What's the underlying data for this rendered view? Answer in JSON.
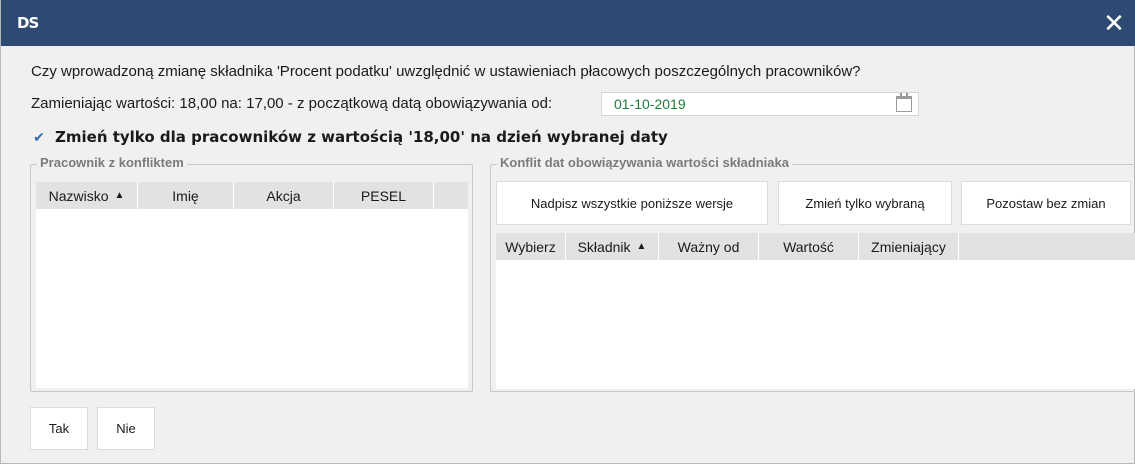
{
  "titlebar": {
    "logo": "DS",
    "close_symbol": "✕",
    "color": "#2d4a72"
  },
  "dialog": {
    "question": "Czy wprowadzoną zmianę składnika 'Procent podatku' uwzględnić w ustawieniach płacowych poszczególnych pracowników?",
    "replace_label": "Zamieniając wartości: 18,00 na: 17,00 - z początkową datą obowiązywania od:",
    "date_value": "01-10-2019",
    "checkbox": {
      "checked": true,
      "label": "Zmień tylko dla pracowników z wartością '18,00' na dzień wybranej daty"
    }
  },
  "employees_group": {
    "title": "Pracownik z konfliktem",
    "columns": [
      "Nazwisko",
      "Imię",
      "Akcja",
      "PESEL"
    ],
    "sorted_column": "Nazwisko",
    "rows": []
  },
  "conflict_group": {
    "title": "Konflit dat obowiązywania wartości składniaka",
    "buttons": {
      "overwrite_all": "Nadpisz wszystkie poniższe wersje",
      "change_selected": "Zmień tylko wybraną",
      "leave_unchanged": "Pozostaw bez zmian"
    },
    "columns": [
      "Wybierz",
      "Składnik",
      "Ważny od",
      "Wartość",
      "Zmieniający"
    ],
    "sorted_column": "Składnik",
    "rows": []
  },
  "footer": {
    "yes_label": "Tak",
    "no_label": "Nie"
  }
}
